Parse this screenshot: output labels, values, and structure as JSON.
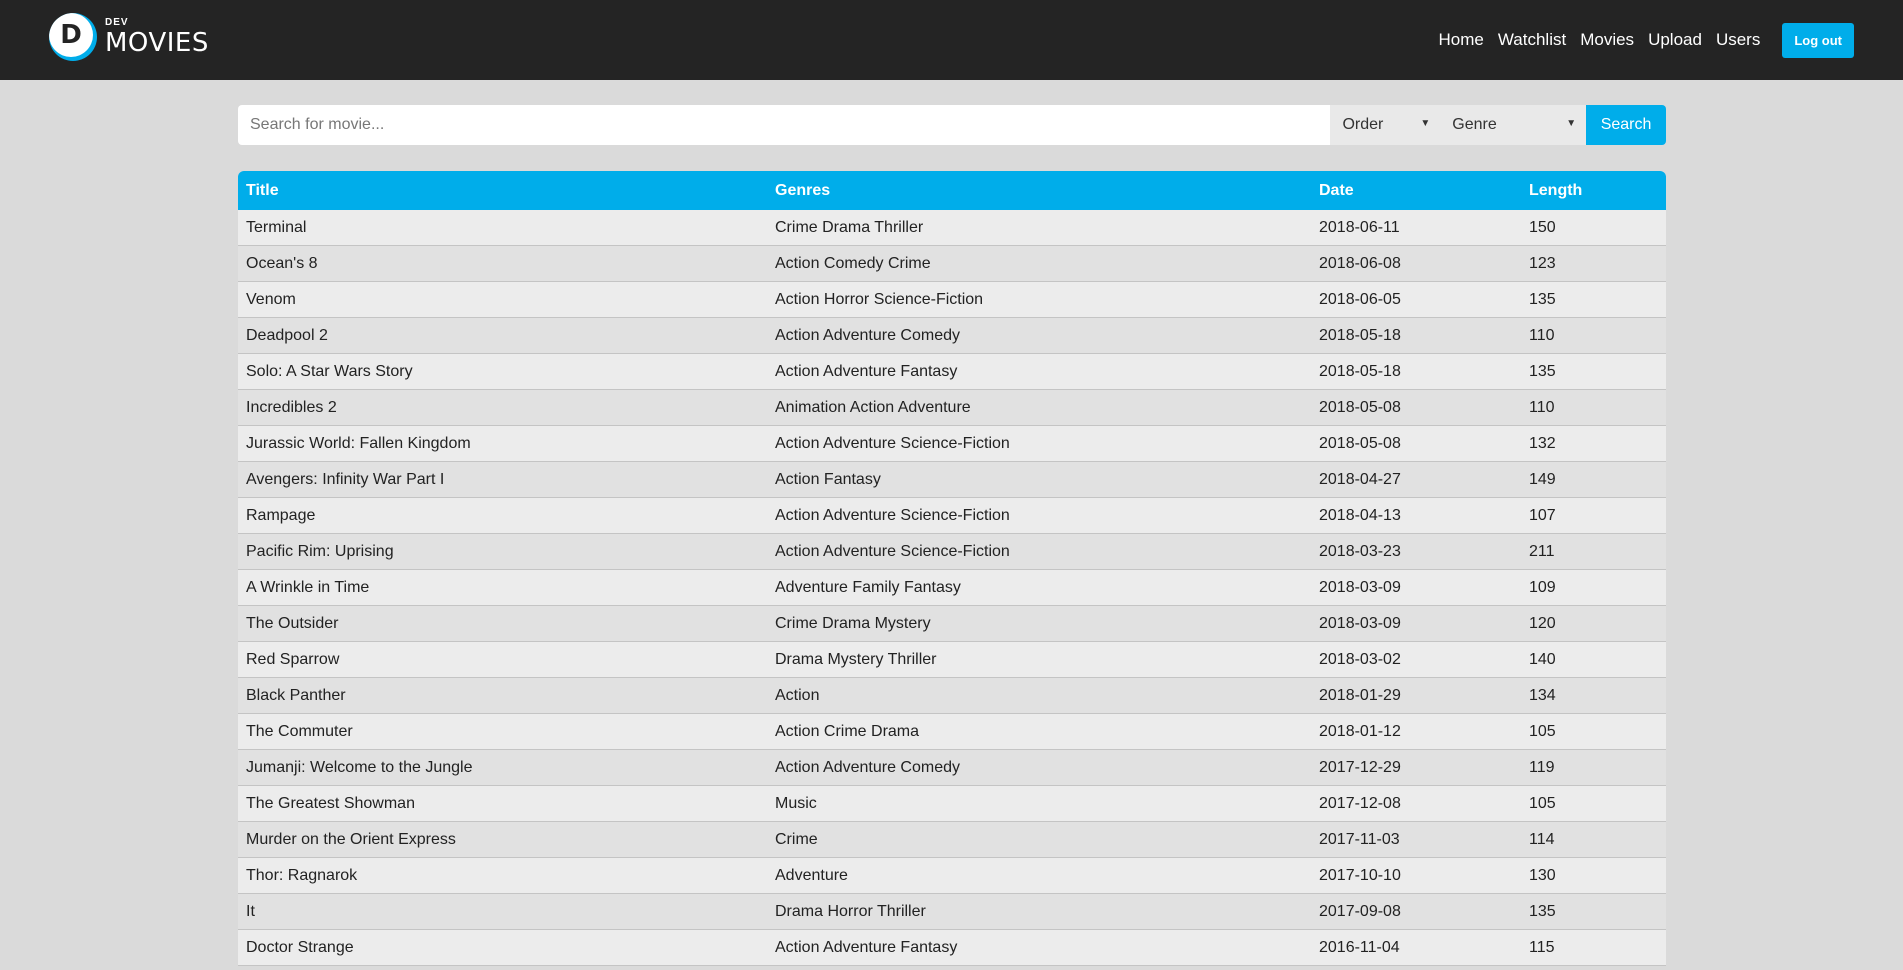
{
  "brand": {
    "small": "DEV",
    "big": "MOVIES",
    "mark": "D"
  },
  "nav": {
    "items": [
      "Home",
      "Watchlist",
      "Movies",
      "Upload",
      "Users"
    ],
    "logout": "Log out"
  },
  "search": {
    "placeholder": "Search for movie...",
    "order": "Order",
    "genre": "Genre",
    "button": "Search"
  },
  "table": {
    "columns": [
      "Title",
      "Genres",
      "Date",
      "Length"
    ],
    "rows": [
      [
        "Terminal",
        "Crime Drama Thriller",
        "2018-06-11",
        "150"
      ],
      [
        "Ocean's 8",
        "Action Comedy Crime",
        "2018-06-08",
        "123"
      ],
      [
        "Venom",
        "Action Horror Science-Fiction",
        "2018-06-05",
        "135"
      ],
      [
        "Deadpool 2",
        "Action Adventure Comedy",
        "2018-05-18",
        "110"
      ],
      [
        "Solo: A Star Wars Story",
        "Action Adventure Fantasy",
        "2018-05-18",
        "135"
      ],
      [
        "Incredibles 2",
        "Animation Action Adventure",
        "2018-05-08",
        "110"
      ],
      [
        "Jurassic World: Fallen Kingdom",
        "Action Adventure Science-Fiction",
        "2018-05-08",
        "132"
      ],
      [
        "Avengers: Infinity War Part I",
        "Action Fantasy",
        "2018-04-27",
        "149"
      ],
      [
        "Rampage",
        "Action Adventure Science-Fiction",
        "2018-04-13",
        "107"
      ],
      [
        "Pacific Rim: Uprising",
        "Action Adventure Science-Fiction",
        "2018-03-23",
        "211"
      ],
      [
        "A Wrinkle in Time",
        "Adventure Family Fantasy",
        "2018-03-09",
        "109"
      ],
      [
        "The Outsider",
        "Crime Drama Mystery",
        "2018-03-09",
        "120"
      ],
      [
        "Red Sparrow",
        "Drama Mystery Thriller",
        "2018-03-02",
        "140"
      ],
      [
        "Black Panther",
        "Action",
        "2018-01-29",
        "134"
      ],
      [
        "The Commuter",
        "Action Crime Drama",
        "2018-01-12",
        "105"
      ],
      [
        "Jumanji: Welcome to the Jungle",
        "Action Adventure Comedy",
        "2017-12-29",
        "119"
      ],
      [
        "The Greatest Showman",
        "Music",
        "2017-12-08",
        "105"
      ],
      [
        "Murder on the Orient Express",
        "Crime",
        "2017-11-03",
        "114"
      ],
      [
        "Thor: Ragnarok",
        "Adventure",
        "2017-10-10",
        "130"
      ],
      [
        "It",
        "Drama Horror Thriller",
        "2017-09-08",
        "135"
      ],
      [
        "Doctor Strange",
        "Action Adventure Fantasy",
        "2016-11-04",
        "115"
      ]
    ]
  },
  "colors": {
    "accent": "#00adea",
    "topbar": "#242424",
    "background": "#dadada"
  }
}
